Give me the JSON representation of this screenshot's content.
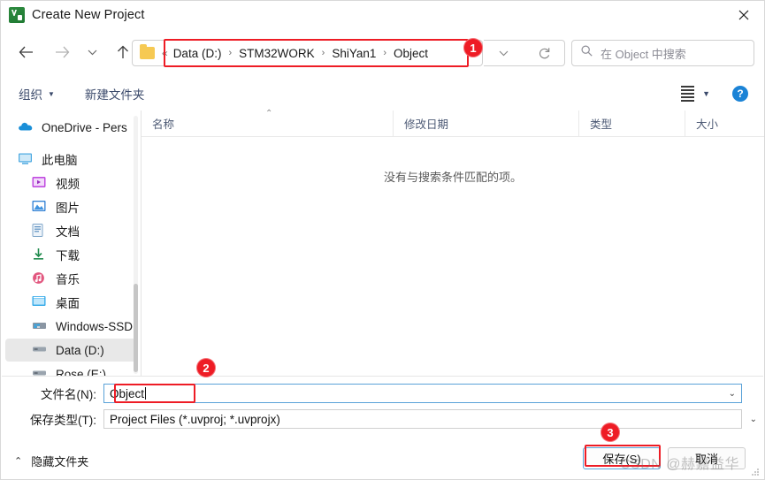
{
  "window": {
    "title": "Create New Project",
    "app_icon": "keil-uvision-icon",
    "close_label": "✕"
  },
  "nav": {
    "back_icon": "arrow-left-icon",
    "forward_icon": "arrow-right-icon",
    "recent_icon": "chevron-down-icon",
    "up_icon": "arrow-up-icon",
    "dropdown_icon": "chevron-down-icon",
    "refresh_icon": "refresh-icon"
  },
  "address_bar": {
    "folder_icon": "folder-icon",
    "lead_chevron": "«",
    "separator": "›",
    "crumbs": [
      "Data (D:)",
      "STM32WORK",
      "ShiYan1",
      "Object"
    ]
  },
  "search": {
    "icon": "search-icon",
    "placeholder": "在 Object 中搜索"
  },
  "toolbar": {
    "organize_label": "组织",
    "organize_caret": "▼",
    "new_folder_label": "新建文件夹",
    "view_icon": "list-view-icon",
    "view_caret": "▼",
    "help_label": "?"
  },
  "sidebar": {
    "items": [
      {
        "label": "OneDrive - Pers",
        "icon": "onedrive-icon",
        "indent": false,
        "selected": false
      },
      {
        "label": "此电脑",
        "icon": "this-pc-icon",
        "indent": false,
        "selected": false
      },
      {
        "label": "视频",
        "icon": "videos-icon",
        "indent": true,
        "selected": false
      },
      {
        "label": "图片",
        "icon": "pictures-icon",
        "indent": true,
        "selected": false
      },
      {
        "label": "文档",
        "icon": "documents-icon",
        "indent": true,
        "selected": false
      },
      {
        "label": "下载",
        "icon": "downloads-icon",
        "indent": true,
        "selected": false
      },
      {
        "label": "音乐",
        "icon": "music-icon",
        "indent": true,
        "selected": false
      },
      {
        "label": "桌面",
        "icon": "desktop-icon",
        "indent": true,
        "selected": false
      },
      {
        "label": "Windows-SSD",
        "icon": "system-drive-icon",
        "indent": true,
        "selected": false
      },
      {
        "label": "Data (D:)",
        "icon": "drive-icon",
        "indent": true,
        "selected": true
      },
      {
        "label": "Rose (E:)",
        "icon": "drive-icon",
        "indent": true,
        "selected": false
      }
    ]
  },
  "file_list": {
    "columns": [
      {
        "label": "名称",
        "sorted": "ascending",
        "sort_caret": "⌃"
      },
      {
        "label": "修改日期",
        "sorted": "",
        "sort_caret": ""
      },
      {
        "label": "类型",
        "sorted": "",
        "sort_caret": ""
      },
      {
        "label": "大小",
        "sorted": "",
        "sort_caret": ""
      }
    ],
    "rows": [],
    "empty_message": "没有与搜索条件匹配的项。"
  },
  "form": {
    "filename_label": "文件名(N):",
    "filename_value": "Object",
    "filetype_label": "保存类型(T):",
    "filetype_value": "Project Files (*.uvproj; *.uvprojx)",
    "combo_arrow": "⌄"
  },
  "footer": {
    "hide_folders_caret": "⌃",
    "hide_folders_label": "隐藏文件夹",
    "save_label": "保存(S)",
    "cancel_label": "取消"
  },
  "annotations": {
    "badges": [
      {
        "number": "1",
        "target": "address-bar"
      },
      {
        "number": "2",
        "target": "filename-input"
      },
      {
        "number": "3",
        "target": "save-button"
      }
    ],
    "highlight_color": "#ee1c25"
  },
  "watermark": {
    "text": "CSDN @赫嘉益华"
  }
}
